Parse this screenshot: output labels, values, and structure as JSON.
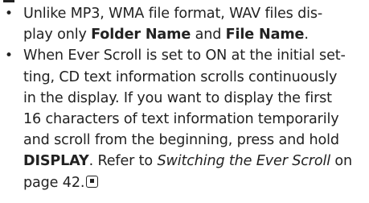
{
  "bullets": [
    {
      "marker": "•",
      "t1": "Unlike MP3, WMA file format, WAV files dis-",
      "t2": "play only ",
      "b1": "Folder Name",
      "t3": " and ",
      "b2": "File Name",
      "t4": "."
    },
    {
      "marker": "•",
      "t1": "When Ever Scroll is set to ON at the initial set-",
      "t2": "ting, CD text information scrolls continuously",
      "t3": "in the display. If you want to display the first",
      "t4": "16 characters of text information temporarily",
      "t5": "and scroll from the beginning, press and hold",
      "b1": "DISPLAY",
      "t6": ". Refer to ",
      "i1": "Switching the Ever Scroll",
      "t7": " on",
      "t8": "page 42.",
      "end_icon": "stop-icon"
    }
  ]
}
